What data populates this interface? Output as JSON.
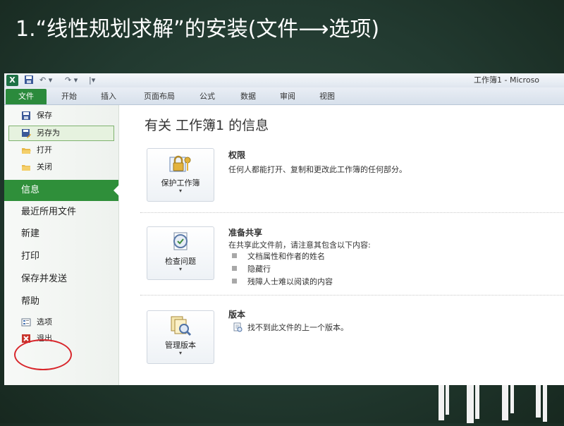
{
  "slide": {
    "title": "1.“线性规划求解”的安装(文件⟶选项)"
  },
  "window": {
    "title": "工作簿1 - Microso",
    "logo": "X"
  },
  "ribbon": {
    "tabs": [
      "文件",
      "开始",
      "插入",
      "页面布局",
      "公式",
      "数据",
      "审阅",
      "视图"
    ]
  },
  "sidebar": {
    "items": [
      {
        "label": "保存",
        "icon": "save-icon"
      },
      {
        "label": "另存为",
        "icon": "save-as-icon"
      },
      {
        "label": "打开",
        "icon": "open-folder-icon"
      },
      {
        "label": "关闭",
        "icon": "close-folder-icon"
      }
    ],
    "categories": [
      "信息",
      "最近所用文件",
      "新建",
      "打印",
      "保存并发送",
      "帮助"
    ],
    "bottom_items": [
      {
        "label": "选项",
        "icon": "options-icon"
      },
      {
        "label": "退出",
        "icon": "exit-icon"
      }
    ]
  },
  "main": {
    "title": "有关 工作簿1 的信息",
    "sections": [
      {
        "button": "保护工作簿",
        "heading": "权限",
        "text": "任何人都能打开、复制和更改此工作簿的任何部分。"
      },
      {
        "button": "检查问题",
        "heading": "准备共享",
        "text": "在共享此文件前，请注意其包含以下内容:",
        "bullets": [
          "文档属性和作者的姓名",
          "隐藏行",
          "残障人士难以阅读的内容"
        ]
      },
      {
        "button": "管理版本",
        "heading": "版本",
        "text": "找不到此文件的上一个版本。"
      }
    ]
  }
}
